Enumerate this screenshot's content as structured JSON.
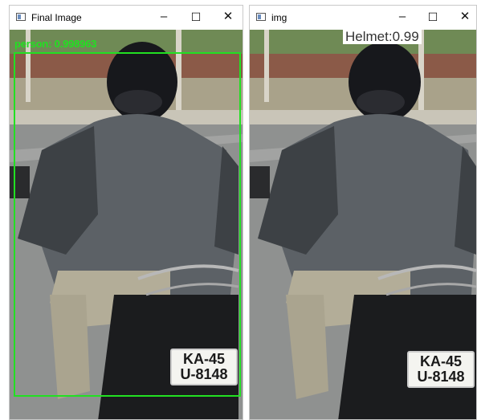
{
  "windows": [
    {
      "title": "Final Image",
      "controls": {
        "minimize": "–",
        "maximize": "☐",
        "close": "✕"
      },
      "detection": {
        "label": "person: 0.998963",
        "color": "#22e022"
      },
      "plate": {
        "line1": "KA-45",
        "line2": "U-8148"
      }
    },
    {
      "title": "img",
      "controls": {
        "minimize": "–",
        "maximize": "☐",
        "close": "✕"
      },
      "detection": {
        "label": "Helmet:0.99"
      },
      "plate": {
        "line1": "KA-45",
        "line2": "U-8148"
      }
    }
  ],
  "icons": [
    "window-app-icon",
    "minimize-icon",
    "maximize-icon",
    "close-icon"
  ]
}
